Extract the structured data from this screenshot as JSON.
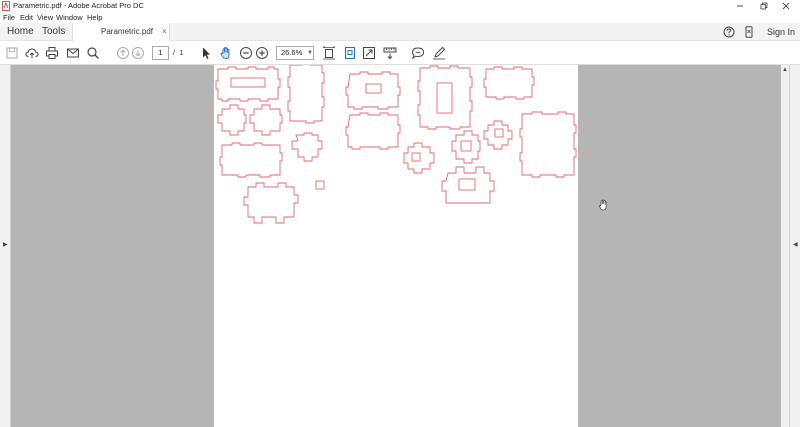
{
  "window": {
    "title": "Parametric.pdf - Adobe Acrobat Pro DC"
  },
  "menu": {
    "items": [
      "File",
      "Edit",
      "View",
      "Window",
      "Help"
    ]
  },
  "tabs": {
    "home_label": "Home",
    "tools_label": "Tools",
    "doc_label": "Parametric.pdf",
    "close_glyph": "×",
    "sign_in_label": "Sign In"
  },
  "toolbar": {
    "current_page": "1",
    "page_separator": "/",
    "total_pages": "1",
    "zoom_value": "26.6%"
  },
  "colors": {
    "shape_stroke": "#e06a70",
    "workspace_bg": "#b5b5b5",
    "accent_blue": "#1e73be"
  },
  "icons": {
    "save": "save-icon",
    "upload": "cloud-upload-icon",
    "print": "print-icon",
    "email": "envelope-icon",
    "search": "search-icon",
    "prev_page": "arrow-up-circle-icon",
    "next_page": "arrow-down-circle-icon",
    "select": "arrow-pointer-icon",
    "hand": "hand-icon",
    "zoom_out": "zoom-out-icon",
    "zoom_in": "zoom-in-icon",
    "help": "help-icon",
    "mobile": "mobile-icon"
  }
}
